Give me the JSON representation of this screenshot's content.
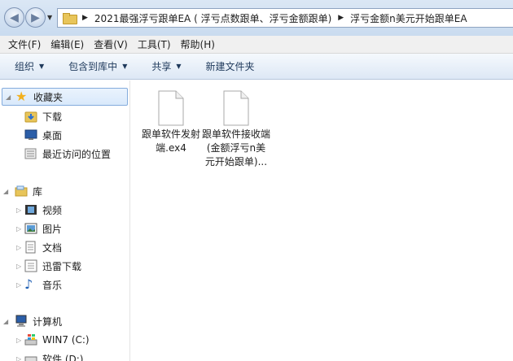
{
  "address": {
    "crumbs": [
      "2021最强浮亏跟单EA ( 浮亏点数跟单、浮亏金额跟单)",
      "浮亏金额n美元开始跟单EA"
    ]
  },
  "menu": [
    "文件(F)",
    "编辑(E)",
    "查看(V)",
    "工具(T)",
    "帮助(H)"
  ],
  "toolbar": {
    "organize": "组织",
    "include_in_library": "包含到库中",
    "share": "共享",
    "new_folder": "新建文件夹"
  },
  "nav": {
    "favorites": {
      "label": "收藏夹",
      "items": [
        "下载",
        "桌面",
        "最近访问的位置"
      ]
    },
    "libraries": {
      "label": "库",
      "items": [
        "视频",
        "图片",
        "文档",
        "迅雷下载",
        "音乐"
      ]
    },
    "computer": {
      "label": "计算机",
      "items": [
        "WIN7 (C:)",
        "软件 (D:)"
      ]
    }
  },
  "files": [
    {
      "name": "跟单软件发射端.ex4"
    },
    {
      "name": "跟单软件接收端 (金额浮亏n美元开始跟单)..."
    }
  ],
  "colors": {
    "selection": "#d9e9fb",
    "accent": "#1e395b",
    "folder": "#e8c55a"
  }
}
